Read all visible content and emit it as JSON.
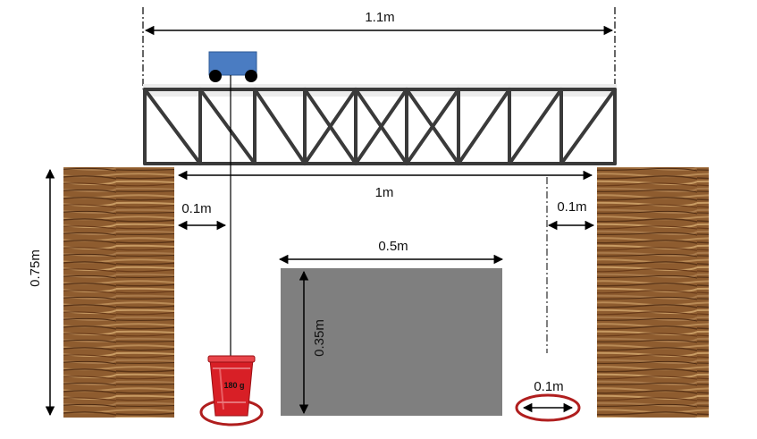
{
  "dimensions": {
    "bridge_span": "1.1m",
    "gap_span": "1m",
    "left_clearance": "0.1m",
    "right_clearance": "0.1m",
    "obstacle_width": "0.5m",
    "obstacle_height": "0.35m",
    "bank_height": "0.75m",
    "target_circle": "0.1m"
  },
  "cup": {
    "label": "180 g"
  },
  "colors": {
    "cart": "#4a7cc2",
    "obstacle": "#7f7f7f",
    "target_ring": "#b01e1e",
    "cup": "#d81f26",
    "bank_wood": "#8a5a30",
    "truss": "#3a3a3a"
  }
}
